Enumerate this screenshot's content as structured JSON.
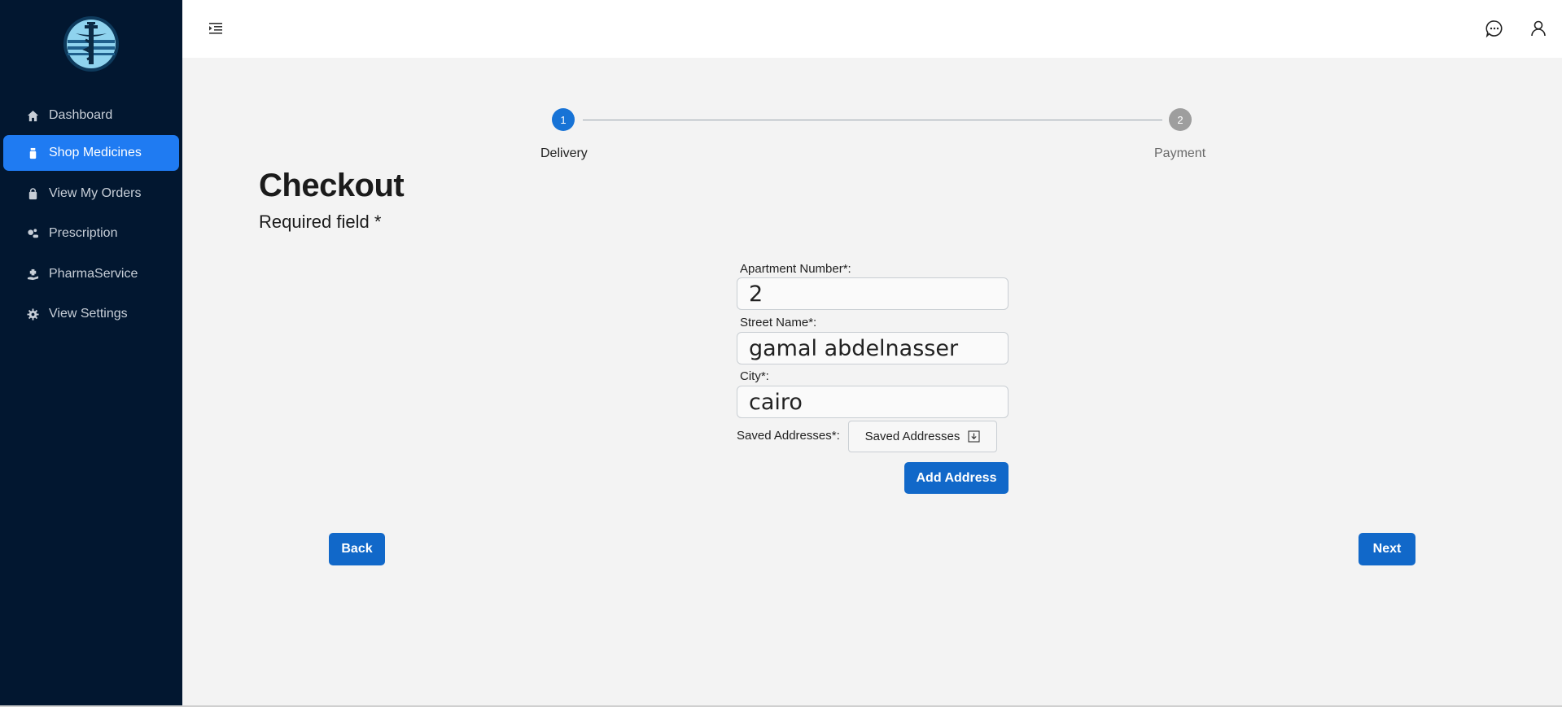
{
  "sidebar": {
    "items": [
      {
        "label": "Dashboard",
        "icon": "home-icon"
      },
      {
        "label": "Shop Medicines",
        "icon": "medicine-bottle-icon",
        "active": true
      },
      {
        "label": "View My Orders",
        "icon": "shopping-bag-icon"
      },
      {
        "label": "Prescription",
        "icon": "pills-icon"
      },
      {
        "label": "PharmaService",
        "icon": "hand-holding-medical-icon"
      },
      {
        "label": "View Settings",
        "icon": "gear-icon"
      }
    ]
  },
  "stepper": {
    "steps": [
      {
        "number": "1",
        "label": "Delivery",
        "active": true
      },
      {
        "number": "2",
        "label": "Payment",
        "active": false
      }
    ]
  },
  "checkout": {
    "title": "Checkout",
    "subtitle": "Required field *"
  },
  "form": {
    "apartment": {
      "label": "Apartment Number*:",
      "value": "2"
    },
    "street": {
      "label": "Street Name*:",
      "value": "gamal abdelnasser"
    },
    "city": {
      "label": "City*:",
      "value": "cairo"
    },
    "saved_addresses": {
      "label": "Saved Addresses*:",
      "selected": "Saved Addresses"
    },
    "add_address_label": "Add Address"
  },
  "navigation": {
    "back_label": "Back",
    "next_label": "Next"
  },
  "colors": {
    "sidebar_bg": "#021730",
    "active_item": "#1f7bf2",
    "button": "#1168c9",
    "step_active": "#1773d6",
    "step_inactive": "#9e9e9e"
  }
}
